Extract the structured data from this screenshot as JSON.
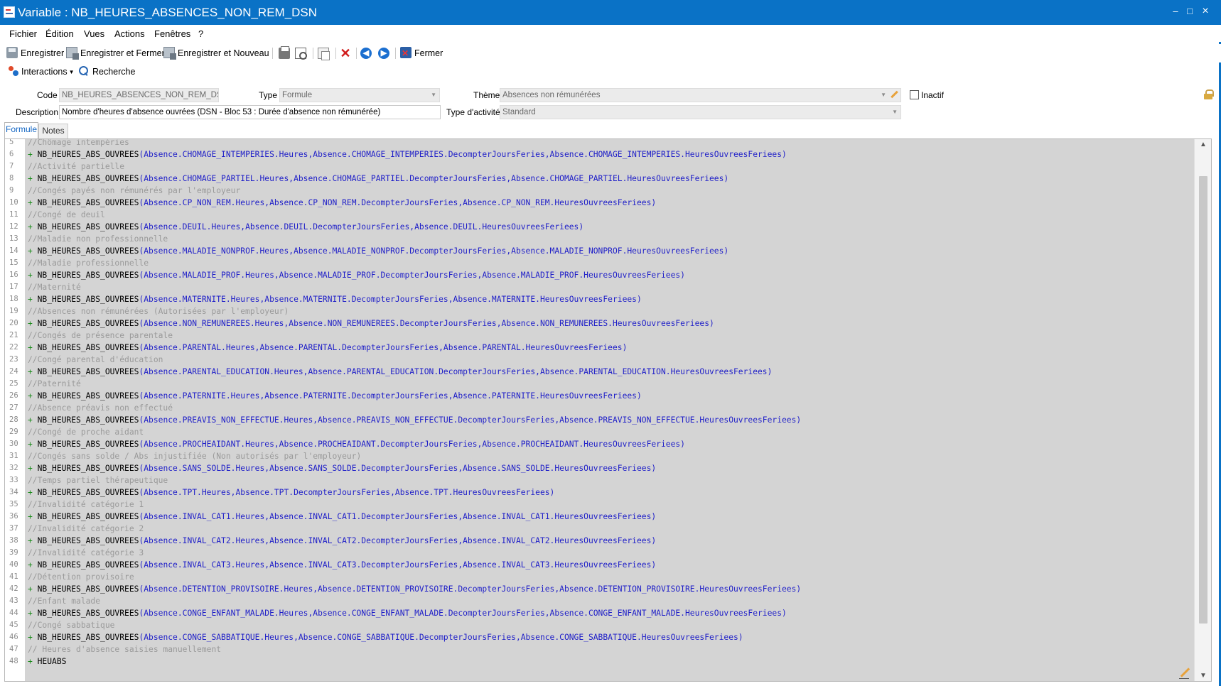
{
  "window": {
    "title": "Variable : NB_HEURES_ABSENCES_NON_REM_DSN",
    "minimize": "–",
    "maximize": "□",
    "close": "×"
  },
  "menu": [
    "Fichier",
    "Édition",
    "Vues",
    "Actions",
    "Fenêtres",
    "?"
  ],
  "toolbar": {
    "save": "Enregistrer",
    "save_close": "Enregistrer et Fermer",
    "save_new": "Enregistrer et Nouveau",
    "close": "Fermer",
    "icons": [
      "print-icon",
      "print-preview-icon",
      "copy-icon",
      "delete-icon",
      "previous-icon",
      "next-icon"
    ]
  },
  "toolbar2": {
    "interactions": "Interactions",
    "search": "Recherche"
  },
  "form": {
    "code_label": "Code",
    "code_value": "NB_HEURES_ABSENCES_NON_REM_DSN",
    "type_label": "Type",
    "type_value": "Formule",
    "theme_label": "Thème",
    "theme_value": "Absences non rémunérées",
    "inactive_label": "Inactif",
    "inactive_checked": false,
    "description_label": "Description",
    "description_value": "Nombre d'heures d'absence ouvrées (DSN - Bloc 53 : Durée d'absence non rémunérée)",
    "activity_label": "Type d'activité",
    "activity_value": "Standard"
  },
  "tabs": [
    "Formule",
    "Notes"
  ],
  "active_tab": "Formule",
  "colors": {
    "titlebar": "#0a72c6",
    "code_bg": "#d4d4d4",
    "comment": "#9a9a9a",
    "plus": "#1a8a1a",
    "arg": "#1f1fc8"
  },
  "editor": {
    "lines": [
      {
        "n": "5",
        "kind": "comment",
        "text": "//Chômage intempéries"
      },
      {
        "n": "6",
        "kind": "call",
        "fn": "NB_HEURES_ABS_OUVREES",
        "args": "(Absence.CHOMAGE_INTEMPERIES.Heures,Absence.CHOMAGE_INTEMPERIES.DecompterJoursFeries,Absence.CHOMAGE_INTEMPERIES.HeuresOuvreesFeriees)"
      },
      {
        "n": "7",
        "kind": "comment",
        "text": "//Activité partielle"
      },
      {
        "n": "8",
        "kind": "call",
        "fn": "NB_HEURES_ABS_OUVREES",
        "args": "(Absence.CHOMAGE_PARTIEL.Heures,Absence.CHOMAGE_PARTIEL.DecompterJoursFeries,Absence.CHOMAGE_PARTIEL.HeuresOuvreesFeriees)"
      },
      {
        "n": "9",
        "kind": "comment",
        "text": "//Congés payés non rémunérés par l'employeur"
      },
      {
        "n": "10",
        "kind": "call",
        "fn": "NB_HEURES_ABS_OUVREES",
        "args": "(Absence.CP_NON_REM.Heures,Absence.CP_NON_REM.DecompterJoursFeries,Absence.CP_NON_REM.HeuresOuvreesFeriees)"
      },
      {
        "n": "11",
        "kind": "comment",
        "text": "//Congé de deuil"
      },
      {
        "n": "12",
        "kind": "call",
        "fn": "NB_HEURES_ABS_OUVREES",
        "args": "(Absence.DEUIL.Heures,Absence.DEUIL.DecompterJoursFeries,Absence.DEUIL.HeuresOuvreesFeriees)"
      },
      {
        "n": "13",
        "kind": "comment",
        "text": "//Maladie non professionnelle"
      },
      {
        "n": "14",
        "kind": "call",
        "fn": "NB_HEURES_ABS_OUVREES",
        "args": "(Absence.MALADIE_NONPROF.Heures,Absence.MALADIE_NONPROF.DecompterJoursFeries,Absence.MALADIE_NONPROF.HeuresOuvreesFeriees)"
      },
      {
        "n": "15",
        "kind": "comment",
        "text": "//Maladie professionnelle"
      },
      {
        "n": "16",
        "kind": "call",
        "fn": "NB_HEURES_ABS_OUVREES",
        "args": "(Absence.MALADIE_PROF.Heures,Absence.MALADIE_PROF.DecompterJoursFeries,Absence.MALADIE_PROF.HeuresOuvreesFeriees)"
      },
      {
        "n": "17",
        "kind": "comment",
        "text": "//Maternité"
      },
      {
        "n": "18",
        "kind": "call",
        "fn": "NB_HEURES_ABS_OUVREES",
        "args": "(Absence.MATERNITE.Heures,Absence.MATERNITE.DecompterJoursFeries,Absence.MATERNITE.HeuresOuvreesFeriees)"
      },
      {
        "n": "19",
        "kind": "comment",
        "text": "//Absences non rémunérées (Autorisées par l'employeur)"
      },
      {
        "n": "20",
        "kind": "call",
        "fn": "NB_HEURES_ABS_OUVREES",
        "args": "(Absence.NON_REMUNEREES.Heures,Absence.NON_REMUNEREES.DecompterJoursFeries,Absence.NON_REMUNEREES.HeuresOuvreesFeriees)"
      },
      {
        "n": "21",
        "kind": "comment",
        "text": "//Congés de présence parentale"
      },
      {
        "n": "22",
        "kind": "call",
        "fn": "NB_HEURES_ABS_OUVREES",
        "args": "(Absence.PARENTAL.Heures,Absence.PARENTAL.DecompterJoursFeries,Absence.PARENTAL.HeuresOuvreesFeriees)"
      },
      {
        "n": "23",
        "kind": "comment",
        "text": "//Congé parental d'éducation"
      },
      {
        "n": "24",
        "kind": "call",
        "fn": "NB_HEURES_ABS_OUVREES",
        "args": "(Absence.PARENTAL_EDUCATION.Heures,Absence.PARENTAL_EDUCATION.DecompterJoursFeries,Absence.PARENTAL_EDUCATION.HeuresOuvreesFeriees)"
      },
      {
        "n": "25",
        "kind": "comment",
        "text": "//Paternité"
      },
      {
        "n": "26",
        "kind": "call",
        "fn": "NB_HEURES_ABS_OUVREES",
        "args": "(Absence.PATERNITE.Heures,Absence.PATERNITE.DecompterJoursFeries,Absence.PATERNITE.HeuresOuvreesFeriees)"
      },
      {
        "n": "27",
        "kind": "comment",
        "text": "//Absence préavis non effectué"
      },
      {
        "n": "28",
        "kind": "call",
        "fn": "NB_HEURES_ABS_OUVREES",
        "args": "(Absence.PREAVIS_NON_EFFECTUE.Heures,Absence.PREAVIS_NON_EFFECTUE.DecompterJoursFeries,Absence.PREAVIS_NON_EFFECTUE.HeuresOuvreesFeriees)"
      },
      {
        "n": "29",
        "kind": "comment",
        "text": "//Congé de proche aidant"
      },
      {
        "n": "30",
        "kind": "call",
        "fn": "NB_HEURES_ABS_OUVREES",
        "args": "(Absence.PROCHEAIDANT.Heures,Absence.PROCHEAIDANT.DecompterJoursFeries,Absence.PROCHEAIDANT.HeuresOuvreesFeriees)"
      },
      {
        "n": "31",
        "kind": "comment",
        "text": "//Congés sans solde / Abs injustifiée (Non autorisés par l'employeur)"
      },
      {
        "n": "32",
        "kind": "call",
        "fn": "NB_HEURES_ABS_OUVREES",
        "args": "(Absence.SANS_SOLDE.Heures,Absence.SANS_SOLDE.DecompterJoursFeries,Absence.SANS_SOLDE.HeuresOuvreesFeriees)"
      },
      {
        "n": "33",
        "kind": "comment",
        "text": "//Temps partiel thérapeutique"
      },
      {
        "n": "34",
        "kind": "call",
        "fn": "NB_HEURES_ABS_OUVREES",
        "args": "(Absence.TPT.Heures,Absence.TPT.DecompterJoursFeries,Absence.TPT.HeuresOuvreesFeriees)"
      },
      {
        "n": "35",
        "kind": "comment",
        "text": "//Invalidité catégorie 1"
      },
      {
        "n": "36",
        "kind": "call",
        "fn": "NB_HEURES_ABS_OUVREES",
        "args": "(Absence.INVAL_CAT1.Heures,Absence.INVAL_CAT1.DecompterJoursFeries,Absence.INVAL_CAT1.HeuresOuvreesFeriees)"
      },
      {
        "n": "37",
        "kind": "comment",
        "text": "//Invalidité catégorie 2"
      },
      {
        "n": "38",
        "kind": "call",
        "fn": "NB_HEURES_ABS_OUVREES",
        "args": "(Absence.INVAL_CAT2.Heures,Absence.INVAL_CAT2.DecompterJoursFeries,Absence.INVAL_CAT2.HeuresOuvreesFeriees)"
      },
      {
        "n": "39",
        "kind": "comment",
        "text": "//Invalidité catégorie 3"
      },
      {
        "n": "40",
        "kind": "call",
        "fn": "NB_HEURES_ABS_OUVREES",
        "args": "(Absence.INVAL_CAT3.Heures,Absence.INVAL_CAT3.DecompterJoursFeries,Absence.INVAL_CAT3.HeuresOuvreesFeriees)"
      },
      {
        "n": "41",
        "kind": "comment",
        "text": "//Détention provisoire"
      },
      {
        "n": "42",
        "kind": "call",
        "fn": "NB_HEURES_ABS_OUVREES",
        "args": "(Absence.DETENTION_PROVISOIRE.Heures,Absence.DETENTION_PROVISOIRE.DecompterJoursFeries,Absence.DETENTION_PROVISOIRE.HeuresOuvreesFeriees)"
      },
      {
        "n": "43",
        "kind": "comment",
        "text": "//Enfant malade"
      },
      {
        "n": "44",
        "kind": "call",
        "fn": "NB_HEURES_ABS_OUVREES",
        "args": "(Absence.CONGE_ENFANT_MALADE.Heures,Absence.CONGE_ENFANT_MALADE.DecompterJoursFeries,Absence.CONGE_ENFANT_MALADE.HeuresOuvreesFeriees)"
      },
      {
        "n": "45",
        "kind": "comment",
        "text": "//Congé sabbatique"
      },
      {
        "n": "46",
        "kind": "call",
        "fn": "NB_HEURES_ABS_OUVREES",
        "args": "(Absence.CONGE_SABBATIQUE.Heures,Absence.CONGE_SABBATIQUE.DecompterJoursFeries,Absence.CONGE_SABBATIQUE.HeuresOuvreesFeriees)"
      },
      {
        "n": "47",
        "kind": "comment",
        "text": "// Heures d'absence saisies manuellement"
      },
      {
        "n": "48",
        "kind": "call",
        "fn": "HEUABS",
        "args": ""
      }
    ]
  }
}
